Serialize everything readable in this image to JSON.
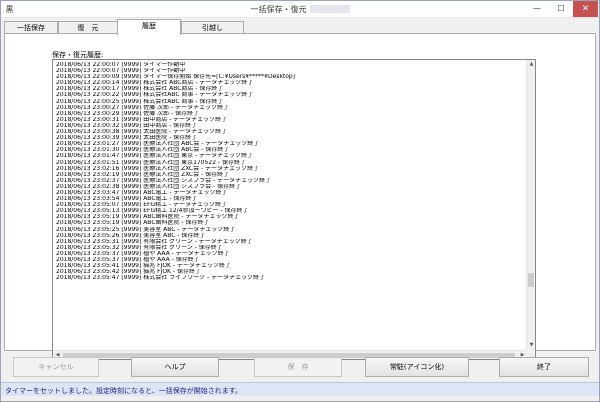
{
  "window": {
    "app_icon": "黒",
    "title": "一括保存・復元",
    "controls": {
      "minimize": "—",
      "maximize": "☐",
      "close": "✕"
    }
  },
  "tabs": [
    {
      "label": "一括保存",
      "active": false
    },
    {
      "label": "復　元",
      "active": false
    },
    {
      "label": "履歴",
      "active": true
    },
    {
      "label": "引越し",
      "active": false
    }
  ],
  "history": {
    "label": "保存・復元履歴:",
    "lines": [
      "2018/06/13 22:00:07 [9999] タイマー作動中",
      "2018/06/13 22:00:07 [9999] タイマー作動中",
      "2018/06/13 22:00:09 [9999] タイマー保存開始 保存先=[C:¥Users¥*****¥Desktop]",
      "2018/06/13 22:00:14 [9999] 株式会社 ABC商店 - データチェック終了",
      "2018/06/13 22:00:17 [9999] 株式会社 ABC商店 - 保存終了",
      "2018/06/13 22:00:22 [9999] 株式会社ABC 商事 - データチェック終了",
      "2018/06/13 22:00:25 [9999] 株式会社ABC 商事 - 保存終了",
      "2018/06/13 23:00:27 [9999] 佐藤 次郎 - データチェック終了",
      "2018/06/13 23:00:29 [9999] 佐藤 次郎 - 保存終了",
      "2018/06/13 23:00:31 [9999] 田中商店 - データチェック終了",
      "2018/06/13 23:00:32 [9999] 田中商店 - 保存終了",
      "2018/06/13 23:00:38 [9999] 太田医院 - データチェック終了",
      "2018/06/13 23:00:39 [9999] 太田医院 - 保存終了",
      "2018/06/13 23:01:27 [9999] 医療法人社団 ABC会 - データチェック終了",
      "2018/06/13 23:01:30 [9999] 医療法人社団 ABC会 - 保存終了",
      "2018/06/13 23:01:47 [9999] 医療法人社団 東京 - データチェック終了",
      "2018/06/13 23:01:51 [9999] 医療法人社団 東京170522 - 保存終了",
      "2018/06/13 23:02:16 [9999] 医療法人社団 ZXC会 - データチェック終了",
      "2018/06/13 23:02:19 [9999] 医療法人社団 ZXC会 - 保存終了",
      "2018/06/13 23:02:37 [9999] 医療法人社団 シスプラ会 - データチェック終了",
      "2018/06/13 23:02:38 [9999] 医療法人社団 シスプラ会 - 保存終了",
      "2018/06/13 23:03:47 [9999] ABC電工 - データチェック終了",
      "2018/06/13 23:03:54 [9999] ABC電工 - 保存終了",
      "2018/06/13 23:05:07 [9999] EFG精工 - データチェック終了",
      "2018/06/13 23:05:13 [9999] EFG精工 12/4参加一つピー - 保存終了",
      "2018/06/13 23:05:19 [9999] ABC歯科医院 - データチェック終了",
      "2018/06/13 23:05:19 [9999] ABC歯科医院 - 保存終了",
      "2018/06/13 23:05:25 [9999] 美容室 ABC - データチェック終了",
      "2018/06/13 23:05:26 [9999] 美容室 ABC - 保存終了",
      "2018/06/13 23:05:31 [9999] 有限会社 グリーン - データチェック終了",
      "2018/06/13 23:05:32 [9999] 有限会社 グリーン - 保存終了",
      "2018/06/13 23:05:37 [9999] 植や AAA - データチェック終了",
      "2018/06/13 23:05:37 [9999] 植や AAA - 保存終了",
      "2018/06/13 23:05:41 [9999] 猫兆 FJOK - データチェック終了",
      "2018/06/13 23:05:42 [9999] 猫兆 FJOK - 保存終了",
      "2018/06/13 23:05:47 [9999] 株式会社 ライフワーク - データチェック終了"
    ]
  },
  "buttons": {
    "cancel": "キャンセル",
    "help": "ヘルプ",
    "save": "保　存",
    "resident": "常駐(アイコン化)",
    "close": "終了"
  },
  "scroll_icons": {
    "up": "▲",
    "down": "▼",
    "left": "◀",
    "right": "▶"
  },
  "status": {
    "message": "タイマーをセットしました。設定時刻になると、一括保存が開始されます。"
  }
}
